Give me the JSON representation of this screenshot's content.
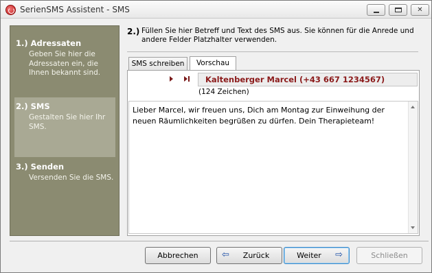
{
  "window": {
    "title": "SerienSMS Assistent - SMS",
    "icon": "seriensms-app-icon"
  },
  "steps": [
    {
      "title": "1.) Adressaten",
      "description": "Geben Sie hier die Adressaten ein, die Ihnen bekannt sind.",
      "active": false
    },
    {
      "title": "2.) SMS",
      "description": "Gestalten Sie hier Ihr SMS.",
      "active": true
    },
    {
      "title": "3.) Senden",
      "description": "Versenden Sie die SMS.",
      "active": false
    }
  ],
  "header": {
    "step_number": "2.)",
    "text": "Füllen Sie hier Betreff und Text des SMS aus. Sie können für die Anrede und andere Felder Platzhalter verwenden."
  },
  "tabs": [
    {
      "label": "SMS schreiben",
      "selected": false
    },
    {
      "label": "Vorschau",
      "selected": true
    }
  ],
  "preview": {
    "recipient": "Kaltenberger Marcel (+43 667 1234567)",
    "char_count": "(124 Zeichen)",
    "message": "Lieber Marcel, wir freuen uns, Dich am Montag zur Einweihung der neuen Räumlichkeiten begrüßen zu dürfen. Dein Therapieteam!"
  },
  "buttons": {
    "cancel": "Abbrechen",
    "back": "Zurück",
    "next": "Weiter",
    "close": "Schließen",
    "back_arrow": "⇦",
    "next_arrow": "⇨"
  },
  "colors": {
    "sidebar": "#8b8b71",
    "sidebar_active": "#a9a994",
    "recipient_text": "#8b1a1a"
  }
}
